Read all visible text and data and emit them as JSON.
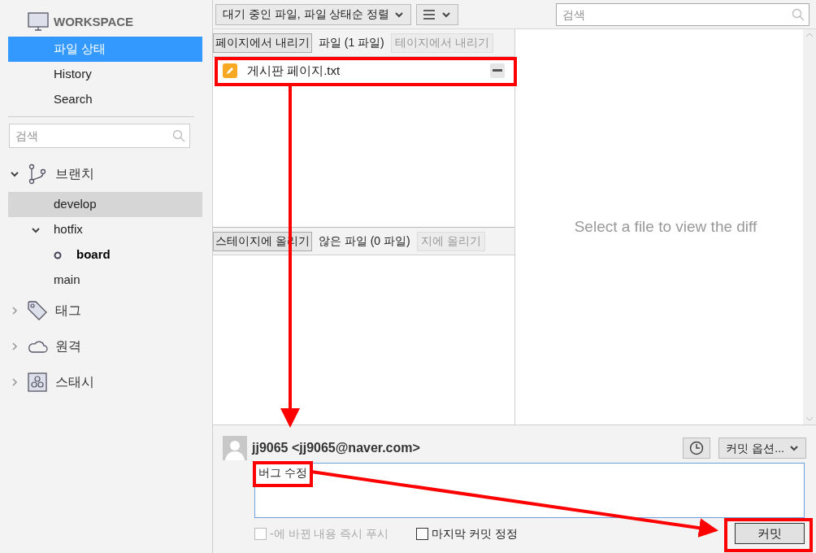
{
  "sidebar": {
    "workspace": {
      "title": "WORKSPACE",
      "items": [
        {
          "label": "파일 상태",
          "selected": true
        },
        {
          "label": "History",
          "selected": false
        },
        {
          "label": "Search",
          "selected": false
        }
      ]
    },
    "search": {
      "placeholder": "검색"
    },
    "sections": [
      {
        "kind": "branch",
        "label": "브랜치",
        "expanded": true,
        "children": [
          {
            "label": "develop",
            "selected": true,
            "current": false
          },
          {
            "label": "hotfix",
            "selected": false,
            "current": false,
            "expanded": true,
            "children": [
              {
                "label": "board",
                "selected": false,
                "current": true
              }
            ]
          },
          {
            "label": "main",
            "selected": false,
            "current": false
          }
        ]
      },
      {
        "kind": "tag",
        "label": "태그",
        "expanded": false
      },
      {
        "kind": "remote",
        "label": "원격",
        "expanded": false
      },
      {
        "kind": "stash",
        "label": "스태시",
        "expanded": false
      }
    ]
  },
  "toolbar": {
    "filter": "대기 중인 파일, 파일 상태순 정렬",
    "search": {
      "placeholder": "검색"
    }
  },
  "staged": {
    "action": "페이지에서 내리기",
    "label": "파일 (1 파일)",
    "action_2": "테이지에서 내리기",
    "files": [
      {
        "name": "게시판 페이지.txt",
        "kind": "modified"
      }
    ]
  },
  "unstaged": {
    "action": "스테이지에 올리기",
    "label": "않은 파일 (0 파일)",
    "action_2": "지에 올리기"
  },
  "diff": {
    "message": "Select a file to view the diff"
  },
  "commit": {
    "author": "jj9065 <jj9065@naver.com>",
    "options": "커밋 옵션...",
    "message": "버그 수정",
    "push": {
      "label": "-에 바뀐 내용 즉시 푸시",
      "checked": false,
      "disabled": true
    },
    "amend": {
      "label": "마지막 커밋 정정",
      "checked": false,
      "disabled": false
    },
    "button": "커밋"
  }
}
